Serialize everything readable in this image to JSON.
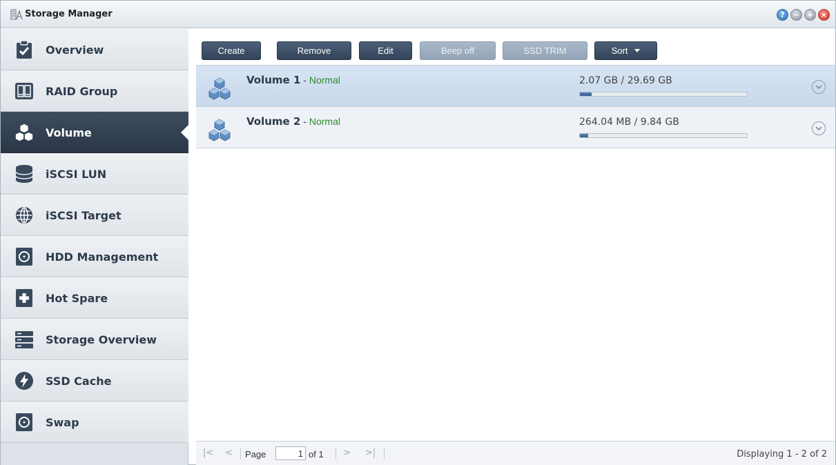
{
  "window": {
    "title": "Storage Manager",
    "controls": [
      {
        "name": "help-icon",
        "glyph": "?"
      },
      {
        "name": "minimize-icon",
        "glyph": "−"
      },
      {
        "name": "maximize-icon",
        "glyph": "+"
      },
      {
        "name": "close-icon",
        "glyph": "×"
      }
    ]
  },
  "sidebar": {
    "items": [
      {
        "label": "Overview",
        "icon": "clipboard-check-icon",
        "active": false
      },
      {
        "label": "RAID Group",
        "icon": "raid-group-icon",
        "active": false
      },
      {
        "label": "Volume",
        "icon": "cubes-icon",
        "active": true
      },
      {
        "label": "iSCSI LUN",
        "icon": "database-icon",
        "active": false
      },
      {
        "label": "iSCSI Target",
        "icon": "globe-icon",
        "active": false
      },
      {
        "label": "HDD Management",
        "icon": "hdd-icon",
        "active": false
      },
      {
        "label": "Hot Spare",
        "icon": "hot-spare-icon",
        "active": false
      },
      {
        "label": "Storage Overview",
        "icon": "server-rack-icon",
        "active": false
      },
      {
        "label": "SSD Cache",
        "icon": "lightning-icon",
        "active": false
      },
      {
        "label": "Swap",
        "icon": "swap-disk-icon",
        "active": false
      }
    ]
  },
  "toolbar": {
    "create_label": "Create",
    "remove_label": "Remove",
    "edit_label": "Edit",
    "beep_off_label": "Beep off",
    "ssd_trim_label": "SSD TRIM",
    "sort_label": "Sort"
  },
  "volumes": [
    {
      "name": "Volume 1",
      "separator": " - ",
      "status": "Normal",
      "usage": "2.07 GB / 29.69 GB",
      "used_fraction": 0.07,
      "selected": true
    },
    {
      "name": "Volume 2",
      "separator": " - ",
      "status": "Normal",
      "usage": "264.04 MB / 9.84 GB",
      "used_fraction": 0.05,
      "selected": false
    }
  ],
  "pagination": {
    "page_label": "Page",
    "current_page": "1",
    "of_label": "of 1",
    "displaying": "Displaying 1 - 2 of 2"
  },
  "colors": {
    "sidebar_active": "#2f3d4f",
    "status_normal": "#2d8a2d",
    "button_primary": "#3e5068",
    "button_disabled": "#9fb0c2"
  }
}
